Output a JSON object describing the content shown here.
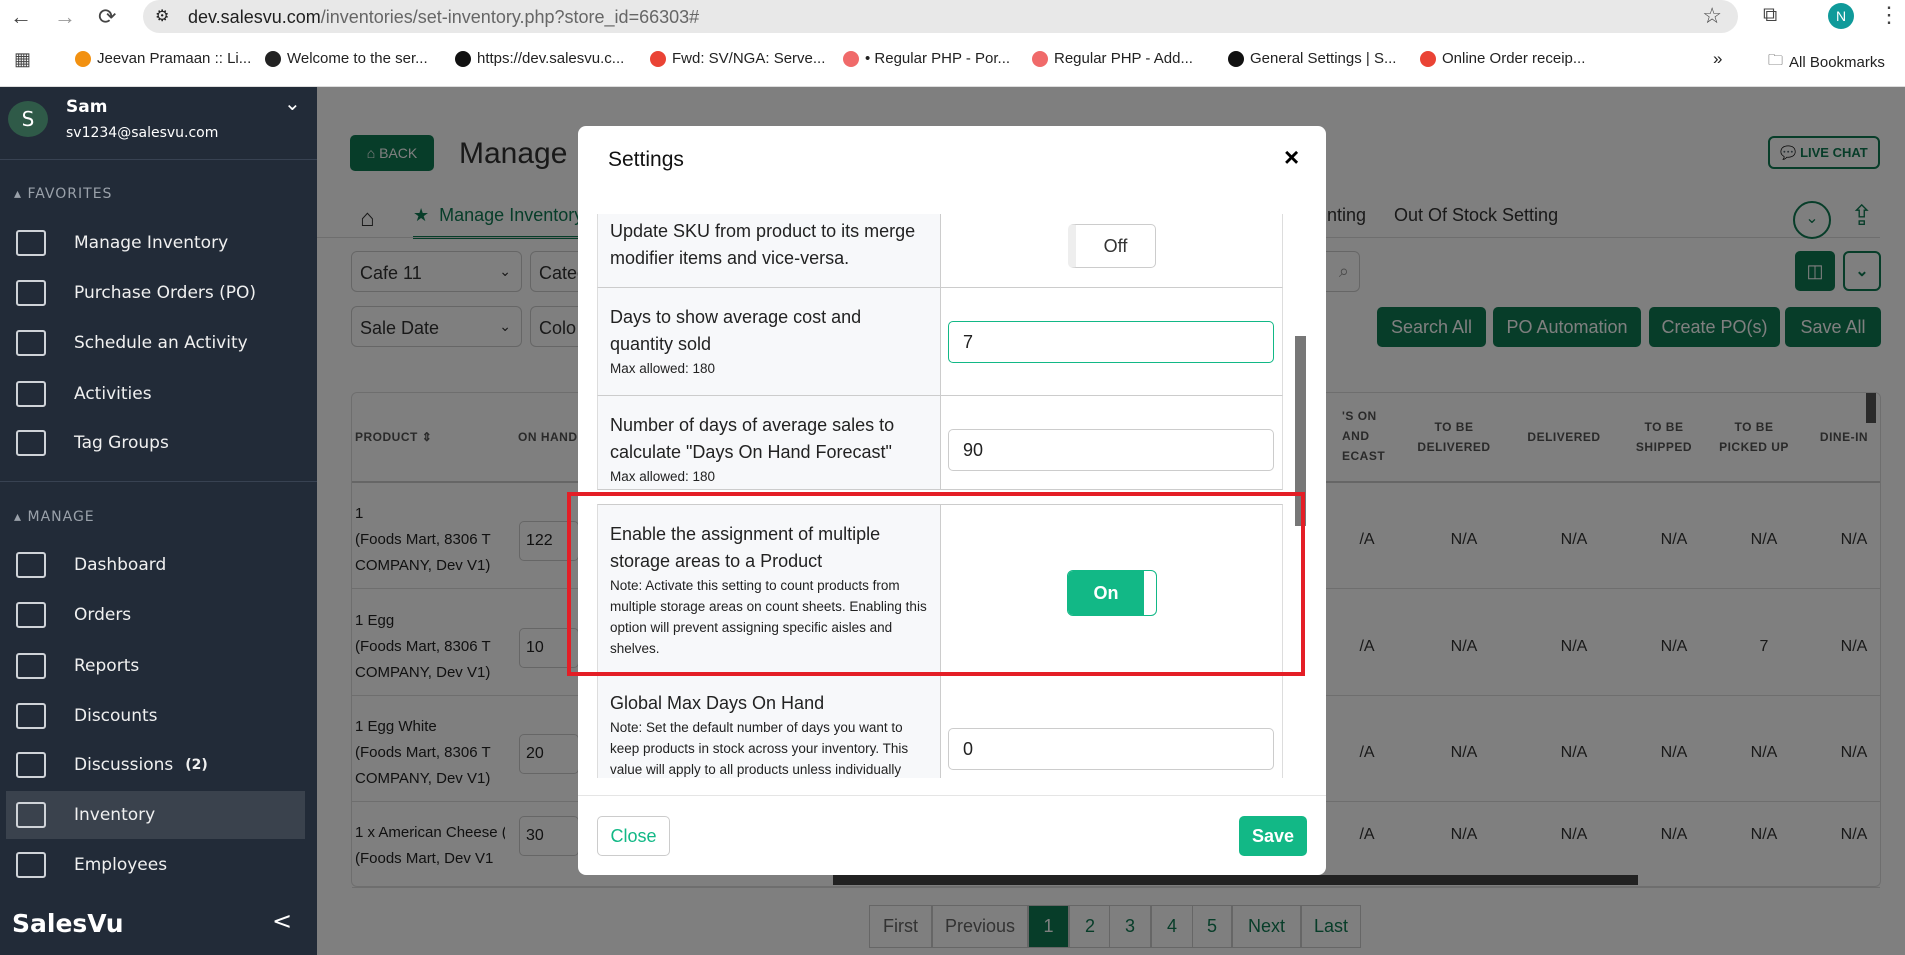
{
  "browser": {
    "url_host": "dev.salesvu.com",
    "url_path": "/inventories/set-inventory.php?store_id=66303#",
    "profile_initial": "N",
    "bookmarks": [
      {
        "label": "Jeevan Pramaan :: Li...",
        "icon": "india-emblem-icon",
        "color": "#f29111"
      },
      {
        "label": "Welcome to the ser...",
        "icon": "globe-icon",
        "color": "#222222"
      },
      {
        "label": "https://dev.salesvu.c...",
        "icon": "sv-icon",
        "color": "#111111"
      },
      {
        "label": "Fwd: SV/NGA: Serve...",
        "icon": "gmail-icon",
        "color": "#ea4335"
      },
      {
        "label": "• Regular PHP - Por...",
        "icon": "asana-icon",
        "color": "#f06a6a"
      },
      {
        "label": "Regular PHP - Add...",
        "icon": "asana-icon",
        "color": "#f06a6a"
      },
      {
        "label": "General Settings | S...",
        "icon": "sv-icon",
        "color": "#111111"
      },
      {
        "label": "Online Order receip...",
        "icon": "gmail-icon",
        "color": "#ea4335"
      }
    ],
    "more": "»",
    "all_bookmarks": "All Bookmarks"
  },
  "sidebar": {
    "user": {
      "initial": "S",
      "name": "Sam",
      "email": "sv1234@salesvu.com"
    },
    "favorites_label": "FAVORITES",
    "favorites": [
      {
        "label": "Manage Inventory",
        "icon": "inventory-icon"
      },
      {
        "label": "Purchase Orders (PO)",
        "icon": "inventory-icon"
      },
      {
        "label": "Schedule an Activity",
        "icon": "calendar-icon"
      },
      {
        "label": "Activities",
        "icon": "activities-icon"
      },
      {
        "label": "Tag Groups",
        "icon": "activities-icon"
      }
    ],
    "manage_label": "MANAGE",
    "manage": [
      {
        "label": "Dashboard",
        "icon": "monitor-icon"
      },
      {
        "label": "Orders",
        "icon": "orders-icon"
      },
      {
        "label": "Reports",
        "icon": "reports-icon"
      },
      {
        "label": "Discounts",
        "icon": "discount-icon"
      },
      {
        "label": "Discussions",
        "icon": "discussions-icon",
        "badge": "(2)"
      },
      {
        "label": "Inventory",
        "icon": "inventory-icon",
        "active": true
      },
      {
        "label": "Employees",
        "icon": "employees-icon"
      }
    ],
    "brand": "SalesVu",
    "collapse": "<"
  },
  "page": {
    "back_label": "BACK",
    "title": "Manage",
    "live_chat": "LIVE CHAT",
    "tabs": {
      "active": "Manage Inventory",
      "partial": "rinting",
      "out_of_stock": "Out Of Stock Setting"
    },
    "filters": {
      "store": "Cafe 11",
      "category": "Categ",
      "sort": "Sale Date",
      "column": "Colo"
    },
    "actions": [
      "Search All",
      "PO Automation",
      "Create PO(s)",
      "Save All"
    ],
    "table": {
      "headers": {
        "product": "PRODUCT",
        "on_hand": "ON HAND",
        "forecast": [
          "'S ON",
          "AND",
          "ECAST"
        ],
        "to_be_delivered": [
          "TO BE",
          "DELIVERED"
        ],
        "delivered": "DELIVERED",
        "to_be_shipped": [
          "TO BE",
          "SHIPPED"
        ],
        "to_be_picked_up": [
          "TO BE",
          "PICKED UP"
        ],
        "dine_in": "DINE-IN"
      },
      "rows": [
        {
          "name": [
            "1",
            "(Foods Mart, 8306 T",
            "COMPANY, Dev V1)"
          ],
          "on_hand": "122",
          "vals": [
            "/A",
            "N/A",
            "N/A",
            "N/A",
            "N/A",
            "N/A"
          ]
        },
        {
          "name": [
            "1 Egg",
            "(Foods Mart, 8306 T",
            "COMPANY, Dev V1)"
          ],
          "on_hand": "10",
          "vals": [
            "/A",
            "N/A",
            "N/A",
            "N/A",
            "7",
            "N/A"
          ]
        },
        {
          "name": [
            "1 Egg White",
            "(Foods Mart, 8306 T",
            "COMPANY, Dev V1)"
          ],
          "on_hand": "20",
          "vals": [
            "/A",
            "N/A",
            "N/A",
            "N/A",
            "N/A",
            "N/A"
          ]
        },
        {
          "name": [
            "1 x American Cheese (",
            "(Foods Mart, Dev V1"
          ],
          "on_hand": "30",
          "vals": [
            "/A",
            "N/A",
            "N/A",
            "N/A",
            "N/A",
            "N/A"
          ]
        }
      ]
    },
    "pagination": {
      "first": "First",
      "previous": "Previous",
      "pages": [
        "1",
        "2",
        "3",
        "4",
        "5"
      ],
      "current": "1",
      "next": "Next",
      "last": "Last"
    }
  },
  "modal": {
    "title": "Settings",
    "close_icon": "×",
    "settings": [
      {
        "label": "Update SKU from product to its merge modifier items and vice-versa.",
        "toggle": "Off"
      },
      {
        "label": "Days to show average cost and quantity sold",
        "note": "Max allowed: 180",
        "value": "7"
      },
      {
        "label": "Number of days of average sales to calculate \"Days On Hand Forecast\"",
        "note": "Max allowed: 180",
        "value": "90"
      },
      {
        "label": "Enable the assignment of multiple storage areas to a Product",
        "note": "Note: Activate this setting to count products from multiple storage areas on count sheets. Enabling this option will prevent assigning specific aisles and shelves.",
        "toggle": "On"
      },
      {
        "label": "Global Max Days On Hand",
        "note": "Note: Set the default number of days you want to keep products in stock across your inventory. This value will apply to all products unless individually",
        "value": "0"
      }
    ],
    "close_label": "Close",
    "save_label": "Save"
  },
  "colors": {
    "brand_green": "#0f7a52",
    "toggle_on": "#12b886",
    "highlight": "#e41e26",
    "sidebar": "#222b38"
  }
}
